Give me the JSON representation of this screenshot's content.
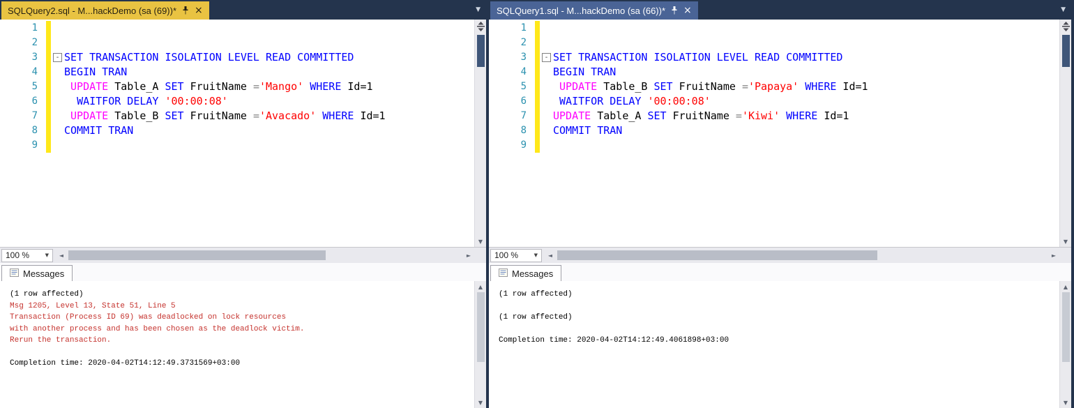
{
  "colors": {
    "tabstrip_bg": "#24344d",
    "active_tab_bg": "#e9c342",
    "active_tab_text": "#241f12",
    "inactive_tab_bg": "#4a6496",
    "inactive_tab_text": "#ffffff",
    "line_number": "#2b91af",
    "change_bar": "#ffe81a",
    "keyword": "#0000ff",
    "dml_keyword": "#ff00ff",
    "string_literal": "#ff0000",
    "operator": "#808080",
    "identifier": "#000000",
    "error_text": "#c5322d",
    "scroll_thumb_dark": "#3f5679"
  },
  "icons": {
    "close": "×",
    "chevron_down": "▼",
    "arrow_up": "▲",
    "arrow_down": "▼",
    "arrow_left": "◄",
    "arrow_right": "►",
    "collapse_minus": "-"
  },
  "panes": [
    {
      "tab_title": "SQLQuery2.sql - M...hackDemo (sa (69))*",
      "zoom_label": "100 %",
      "messages_tab_label": "Messages",
      "code_lines": [
        {
          "num": "1",
          "tokens": []
        },
        {
          "num": "2",
          "tokens": []
        },
        {
          "num": "3",
          "collapse": true,
          "tokens": [
            {
              "t": "SET TRANSACTION ISOLATION LEVEL READ COMMITTED",
              "c": "kw"
            }
          ]
        },
        {
          "num": "4",
          "tokens": [
            {
              "t": "BEGIN TRAN",
              "c": "kw"
            }
          ]
        },
        {
          "num": "5",
          "tokens": [
            {
              "t": " ",
              "c": "id"
            },
            {
              "t": "UPDATE",
              "c": "dml"
            },
            {
              "t": " Table_A ",
              "c": "id"
            },
            {
              "t": "SET",
              "c": "kw"
            },
            {
              "t": " FruitName ",
              "c": "id"
            },
            {
              "t": "=",
              "c": "op"
            },
            {
              "t": "'Mango'",
              "c": "str"
            },
            {
              "t": " ",
              "c": "id"
            },
            {
              "t": "WHERE",
              "c": "kw"
            },
            {
              "t": " Id=1",
              "c": "id"
            }
          ]
        },
        {
          "num": "6",
          "tokens": [
            {
              "t": "  ",
              "c": "id"
            },
            {
              "t": "WAITFOR DELAY",
              "c": "kw"
            },
            {
              "t": " ",
              "c": "id"
            },
            {
              "t": "'00:00:08'",
              "c": "str"
            }
          ]
        },
        {
          "num": "7",
          "tokens": [
            {
              "t": " ",
              "c": "id"
            },
            {
              "t": "UPDATE",
              "c": "dml"
            },
            {
              "t": " Table_B ",
              "c": "id"
            },
            {
              "t": "SET",
              "c": "kw"
            },
            {
              "t": " FruitName ",
              "c": "id"
            },
            {
              "t": "=",
              "c": "op"
            },
            {
              "t": "'Avacado'",
              "c": "str"
            },
            {
              "t": " ",
              "c": "id"
            },
            {
              "t": "WHERE",
              "c": "kw"
            },
            {
              "t": " Id=1",
              "c": "id"
            }
          ]
        },
        {
          "num": "8",
          "tokens": [
            {
              "t": "COMMIT TRAN",
              "c": "kw"
            }
          ]
        },
        {
          "num": "9",
          "tokens": []
        }
      ],
      "messages": [
        {
          "text": "(1 row affected)",
          "c": "black"
        },
        {
          "text": "Msg 1205, Level 13, State 51, Line 5",
          "c": "red"
        },
        {
          "text": "Transaction (Process ID 69) was deadlocked on lock resources",
          "c": "red"
        },
        {
          "text": "with another process and has been chosen as the deadlock victim.",
          "c": "red"
        },
        {
          "text": "Rerun the transaction.",
          "c": "red"
        },
        {
          "text": "",
          "c": "black"
        },
        {
          "text": "Completion time: 2020-04-02T14:12:49.3731569+03:00",
          "c": "black"
        }
      ]
    },
    {
      "tab_title": "SQLQuery1.sql - M...hackDemo (sa (66))*",
      "zoom_label": "100 %",
      "messages_tab_label": "Messages",
      "code_lines": [
        {
          "num": "1",
          "tokens": []
        },
        {
          "num": "2",
          "tokens": []
        },
        {
          "num": "3",
          "collapse": true,
          "tokens": [
            {
              "t": "SET TRANSACTION ISOLATION LEVEL READ COMMITTED",
              "c": "kw"
            }
          ]
        },
        {
          "num": "4",
          "tokens": [
            {
              "t": "BEGIN TRAN",
              "c": "kw"
            }
          ]
        },
        {
          "num": "5",
          "tokens": [
            {
              "t": " ",
              "c": "id"
            },
            {
              "t": "UPDATE",
              "c": "dml"
            },
            {
              "t": " Table_B ",
              "c": "id"
            },
            {
              "t": "SET",
              "c": "kw"
            },
            {
              "t": " FruitName ",
              "c": "id"
            },
            {
              "t": "=",
              "c": "op"
            },
            {
              "t": "'Papaya'",
              "c": "str"
            },
            {
              "t": " ",
              "c": "id"
            },
            {
              "t": "WHERE",
              "c": "kw"
            },
            {
              "t": " Id=1",
              "c": "id"
            }
          ]
        },
        {
          "num": "6",
          "tokens": [
            {
              "t": " ",
              "c": "id"
            },
            {
              "t": "WAITFOR DELAY",
              "c": "kw"
            },
            {
              "t": " ",
              "c": "id"
            },
            {
              "t": "'00:00:08'",
              "c": "str"
            }
          ]
        },
        {
          "num": "7",
          "tokens": [
            {
              "t": "UPDATE",
              "c": "dml"
            },
            {
              "t": " Table_A ",
              "c": "id"
            },
            {
              "t": "SET",
              "c": "kw"
            },
            {
              "t": " FruitName ",
              "c": "id"
            },
            {
              "t": "=",
              "c": "op"
            },
            {
              "t": "'Kiwi'",
              "c": "str"
            },
            {
              "t": " ",
              "c": "id"
            },
            {
              "t": "WHERE",
              "c": "kw"
            },
            {
              "t": " Id=1",
              "c": "id"
            }
          ]
        },
        {
          "num": "8",
          "tokens": [
            {
              "t": "COMMIT TRAN",
              "c": "kw"
            }
          ]
        },
        {
          "num": "9",
          "tokens": []
        }
      ],
      "messages": [
        {
          "text": "(1 row affected)",
          "c": "black"
        },
        {
          "text": "",
          "c": "black"
        },
        {
          "text": "(1 row affected)",
          "c": "black"
        },
        {
          "text": "",
          "c": "black"
        },
        {
          "text": "Completion time: 2020-04-02T14:12:49.4061898+03:00",
          "c": "black"
        }
      ]
    }
  ]
}
